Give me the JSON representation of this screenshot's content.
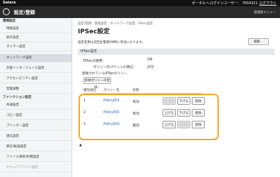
{
  "topbar": {
    "brand": "Satera",
    "portal": "ポータルへ",
    "user": "ログインユーザー： 7654321",
    "logout": "ログアウト"
  },
  "titlebar": {
    "title": "設定/登録",
    "right": "管理者メニュー"
  },
  "sidebar": {
    "section1": "環境設定",
    "items": [
      "用紙設定",
      "表示設定",
      "タイマー設定",
      "ネットワーク設定",
      "外部インターフェイス設定",
      "アクセシビリティ設定",
      "音量調整"
    ],
    "section2": "ファンクション設定",
    "items2": [
      "共通設定",
      "コピー設定",
      "プリンター設定",
      "送信設定",
      "受信/転送設定",
      "ファイル保存/利用設定",
      "セキュアプリント設定"
    ]
  },
  "main": {
    "breadcrumb": "設定/登録：管理設定：ネットワーク設定：IPSec設定",
    "title": "IPSec設定",
    "note": "設定変更は次回主電源ON時に有効になります。",
    "edit_label": "編集...",
    "section": "IPSec設定",
    "use_label": "IPSecの使用：",
    "use_value": "ON",
    "receive_label": "ポリシー外パケットの受信：",
    "receive_value": "許可",
    "registered_label": "登録されているIPSecポリシー",
    "register_button": "新規ポリシーの登録...",
    "columns": [
      "優先順位",
      "ポリシー名",
      "状態"
    ],
    "rows": [
      {
        "num": "1",
        "name": "Policy001",
        "status": "有効"
      },
      {
        "num": "2",
        "name": "Policy002",
        "status": "有効"
      },
      {
        "num": "3",
        "name": "Policy003",
        "status": "無効"
      }
    ],
    "up_label": "上げる",
    "down_label": "下げる",
    "delete_label": "削除",
    "top_link": "▲"
  }
}
